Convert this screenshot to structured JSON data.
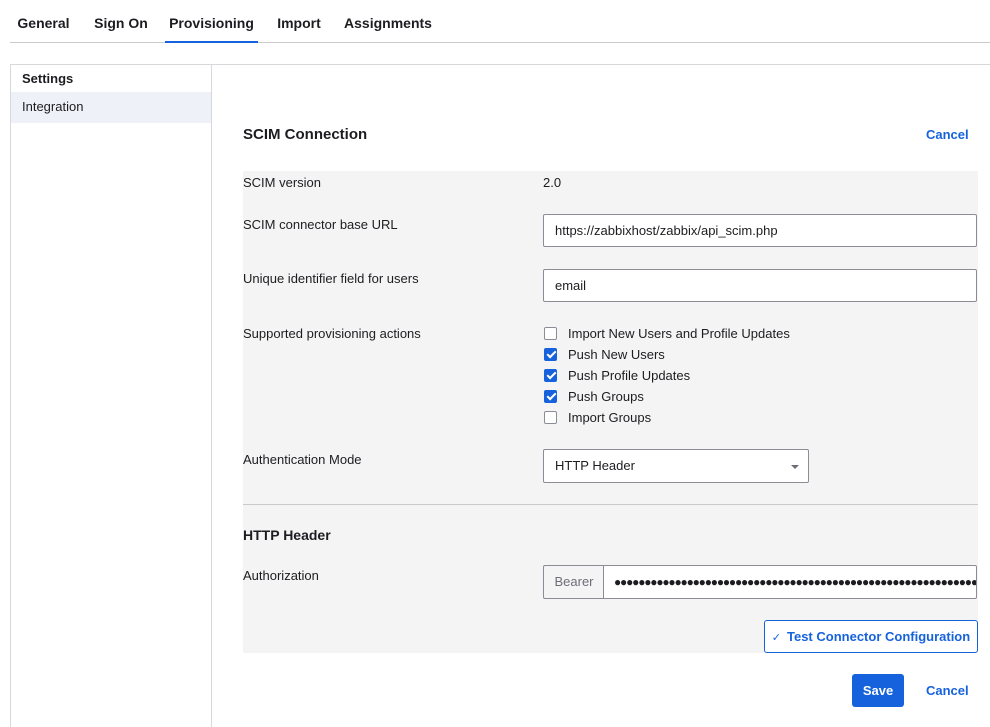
{
  "tabs": [
    {
      "label": "General"
    },
    {
      "label": "Sign On"
    },
    {
      "label": "Provisioning"
    },
    {
      "label": "Import"
    },
    {
      "label": "Assignments"
    }
  ],
  "active_tab": "Provisioning",
  "sidebar": {
    "title": "Settings",
    "items": [
      {
        "label": "Integration"
      }
    ]
  },
  "scim": {
    "title": "SCIM Connection",
    "cancel_label": "Cancel",
    "version_label": "SCIM version",
    "version_value": "2.0",
    "base_url_label": "SCIM connector base URL",
    "base_url_value": "https://zabbixhost/zabbix/api_scim.php",
    "unique_id_label": "Unique identifier field for users",
    "unique_id_value": "email",
    "actions_label": "Supported provisioning actions",
    "actions": [
      {
        "label": "Import New Users and Profile Updates",
        "checked": false
      },
      {
        "label": "Push New Users",
        "checked": true
      },
      {
        "label": "Push Profile Updates",
        "checked": true
      },
      {
        "label": "Push Groups",
        "checked": true
      },
      {
        "label": "Import Groups",
        "checked": false
      }
    ],
    "auth_mode_label": "Authentication Mode",
    "auth_mode_value": "HTTP Header"
  },
  "http_header": {
    "title": "HTTP Header",
    "authorization_label": "Authorization",
    "prefix": "Bearer",
    "token_masked": "●●●●●●●●●●●●●●●●●●●●●●●●●●●●●●●●●●●●●●●●●●●●●●●●●●●●●●●●●●●●●●●●"
  },
  "buttons": {
    "test_label": "Test Connector Configuration",
    "save_label": "Save",
    "cancel_label": "Cancel"
  },
  "colors": {
    "accent": "#1662dd",
    "panel_bg": "#f4f4f4"
  }
}
